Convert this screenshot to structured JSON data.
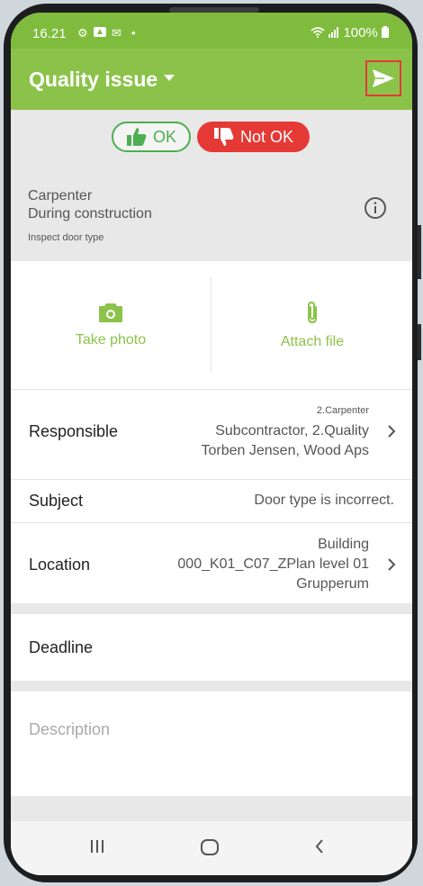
{
  "status_bar": {
    "time": "16.21",
    "icons": [
      "gear-icon",
      "app-icon",
      "mail-icon",
      "dot-icon"
    ],
    "battery": "100%"
  },
  "app_bar": {
    "title": "Quality issue",
    "send_icon": "send-icon"
  },
  "status_toggle": {
    "ok_label": "OK",
    "not_ok_label": "Not OK",
    "selected": "Not OK"
  },
  "header": {
    "trade": "Carpenter",
    "phase": "During construction",
    "checkpoint": "Inspect door type"
  },
  "media": {
    "take_photo": "Take photo",
    "attach_file": "Attach file"
  },
  "fields": {
    "responsible": {
      "label": "Responsible",
      "line1": "2.Carpenter",
      "line2": "Subcontractor, 2.Quality",
      "line3": "Torben Jensen, Wood Aps"
    },
    "subject": {
      "label": "Subject",
      "value": "Door type is incorrect."
    },
    "location": {
      "label": "Location",
      "line1": "Building",
      "line2": "000_K01_C07_ZPlan level 01",
      "line3": "Grupperum"
    },
    "deadline": {
      "label": "Deadline"
    },
    "description": {
      "placeholder": "Description"
    }
  },
  "colors": {
    "brand_green": "#8bc34a",
    "status_green": "#7fbc3d",
    "not_ok_red": "#e53935",
    "ok_green": "#4caf50"
  }
}
